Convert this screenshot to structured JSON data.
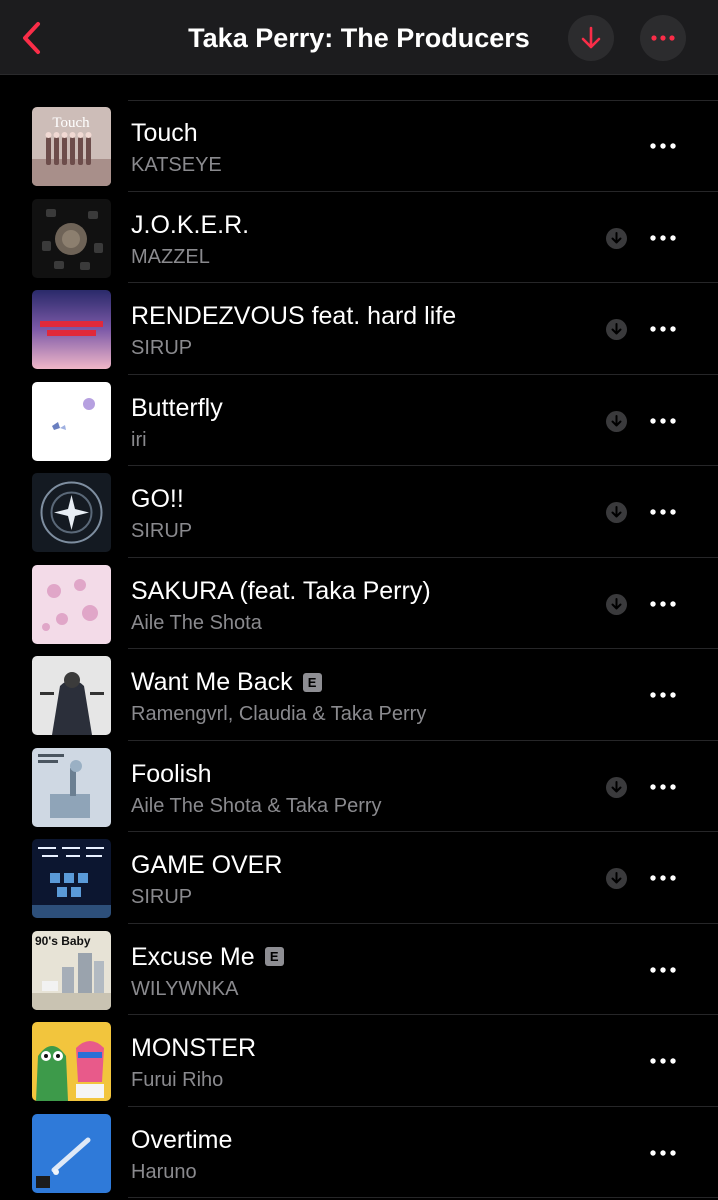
{
  "header": {
    "title": "Taka Perry: The Producers"
  },
  "colors": {
    "accent": "#fa2d48",
    "background": "#000000",
    "header_bg": "#1c1c1e",
    "secondary_text": "#8a8a8e"
  },
  "icons": {
    "back": "chevron-left-icon",
    "download": "arrow-down-icon",
    "more": "ellipsis-icon"
  },
  "songs": [
    {
      "title": "Touch",
      "artist": "KATSEYE",
      "downloaded": false,
      "explicit": false,
      "art_text": "Touch"
    },
    {
      "title": "J.O.K.E.R.",
      "artist": "MAZZEL",
      "downloaded": true,
      "explicit": false
    },
    {
      "title": "RENDEZVOUS feat. hard life",
      "artist": "SIRUP",
      "downloaded": true,
      "explicit": false
    },
    {
      "title": "Butterfly",
      "artist": "iri",
      "downloaded": true,
      "explicit": false
    },
    {
      "title": "GO!!",
      "artist": "SIRUP",
      "downloaded": true,
      "explicit": false
    },
    {
      "title": "SAKURA (feat. Taka Perry)",
      "artist": "Aile The Shota",
      "downloaded": true,
      "explicit": false
    },
    {
      "title": "Want Me Back",
      "artist": "Ramengvrl, Claudia & Taka Perry",
      "downloaded": false,
      "explicit": true
    },
    {
      "title": "Foolish",
      "artist": "Aile The Shota & Taka Perry",
      "downloaded": true,
      "explicit": false
    },
    {
      "title": "GAME OVER",
      "artist": "SIRUP",
      "downloaded": true,
      "explicit": false
    },
    {
      "title": "Excuse Me",
      "artist": "WILYWNKA",
      "downloaded": false,
      "explicit": true,
      "art_text": "90's Baby"
    },
    {
      "title": "MONSTER",
      "artist": "Furui Riho",
      "downloaded": false,
      "explicit": false
    },
    {
      "title": "Overtime",
      "artist": "Haruno",
      "downloaded": false,
      "explicit": false
    }
  ],
  "explicit_label": "E"
}
